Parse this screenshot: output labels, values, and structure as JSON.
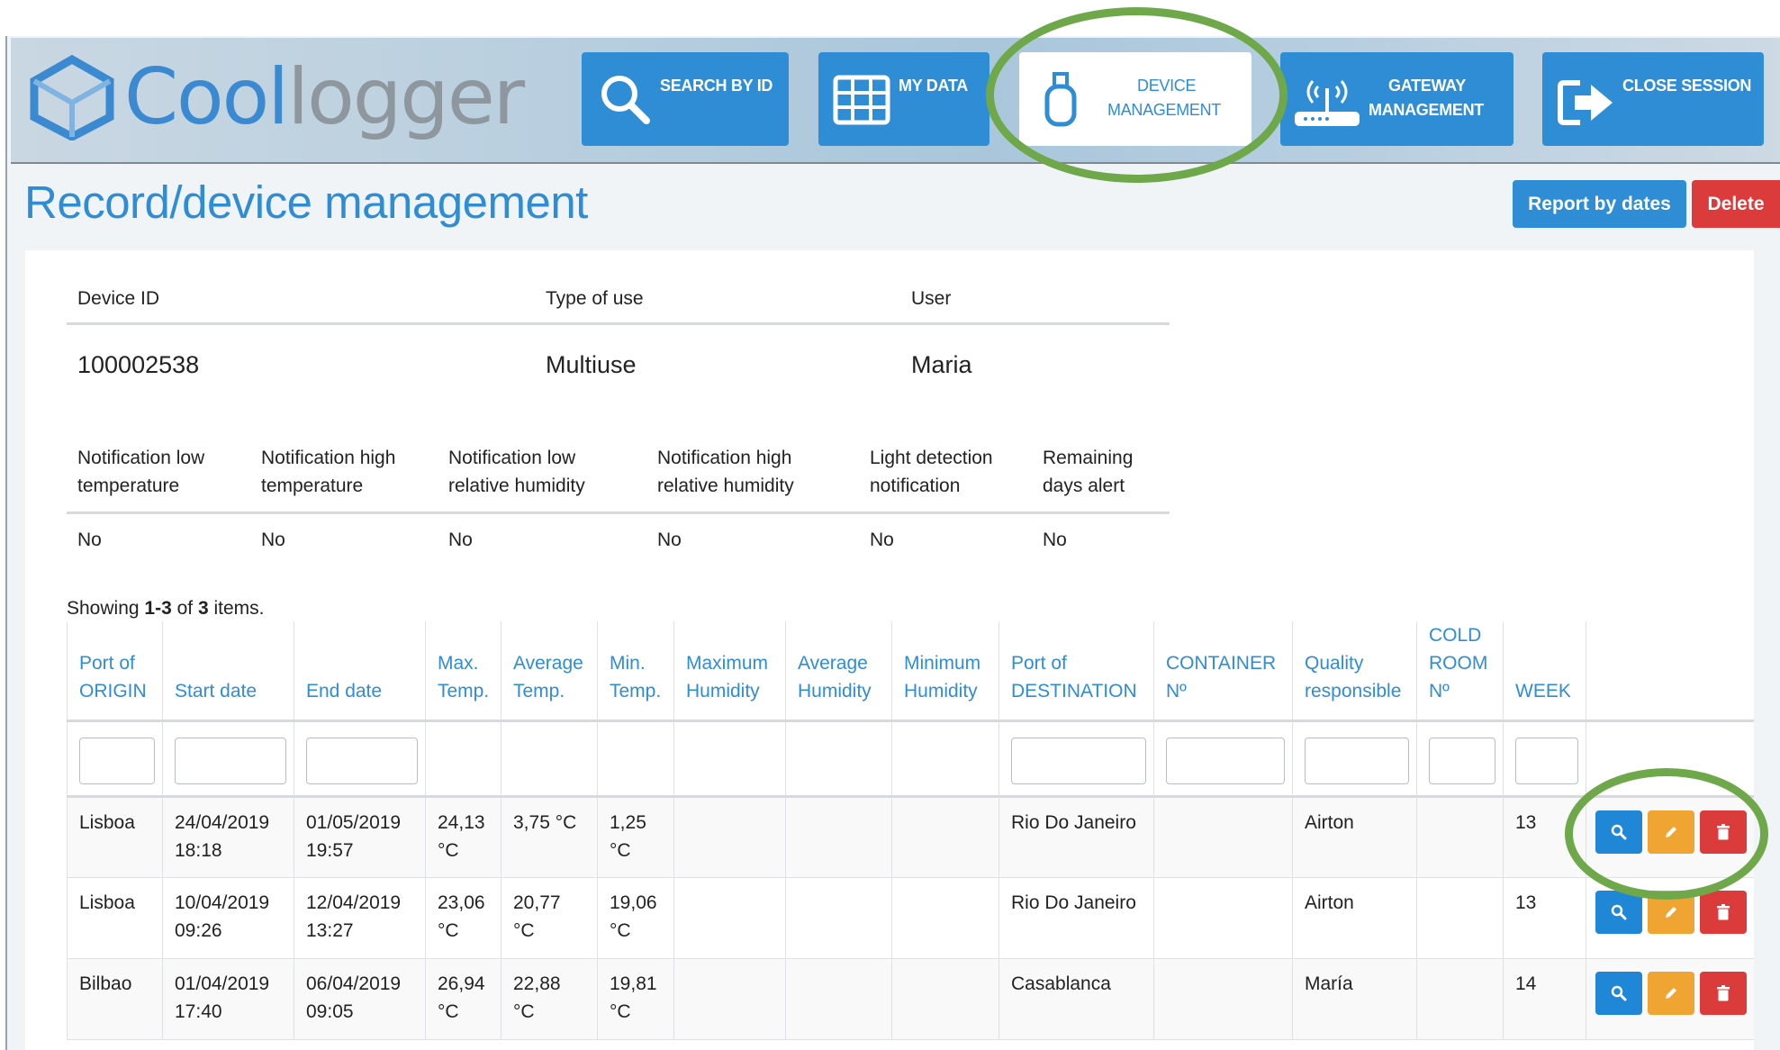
{
  "app": {
    "logo_part1": "Cool",
    "logo_part2": "logger"
  },
  "nav": {
    "search": "SEARCH BY ID",
    "mydata": "MY DATA",
    "device_line1": "DEVICE",
    "device_line2": "MANAGEMENT",
    "gateway_line1": "GATEWAY",
    "gateway_line2": "MANAGEMENT",
    "close": "CLOSE SESSION"
  },
  "page": {
    "title": "Record/device management",
    "report_btn": "Report by dates",
    "delete_btn": "Delete"
  },
  "device": {
    "id_label": "Device ID",
    "type_label": "Type of use",
    "user_label": "User",
    "id": "100002538",
    "type": "Multiuse",
    "user": "Maria"
  },
  "notifications": {
    "headers": [
      [
        "Notification low",
        "temperature"
      ],
      [
        "Notification high",
        "temperature"
      ],
      [
        "Notification low",
        "relative humidity"
      ],
      [
        "Notification high",
        "relative humidity"
      ],
      [
        "Light detection",
        "notification"
      ],
      [
        "Remaining",
        "days alert"
      ]
    ],
    "values": [
      "No",
      "No",
      "No",
      "No",
      "No",
      "No"
    ]
  },
  "summary": {
    "prefix": "Showing ",
    "range": "1-3",
    "of": " of ",
    "total": "3",
    "suffix": " items."
  },
  "table": {
    "headers": [
      [
        "Port of",
        "ORIGIN"
      ],
      [
        "Start date"
      ],
      [
        "End date"
      ],
      [
        "Max.",
        "Temp."
      ],
      [
        "Average",
        "Temp."
      ],
      [
        "Min.",
        "Temp."
      ],
      [
        "Maximum",
        "Humidity"
      ],
      [
        "Average",
        "Humidity"
      ],
      [
        "Minimum",
        "Humidity"
      ],
      [
        "Port of",
        "DESTINATION"
      ],
      [
        "CONTAINER",
        "Nº"
      ],
      [
        "Quality",
        "responsible"
      ],
      [
        "COLD",
        "ROOM",
        "Nº"
      ],
      [
        "WEEK"
      ],
      [
        ""
      ]
    ],
    "rows": [
      [
        [
          "Lisboa"
        ],
        [
          "24/04/2019",
          "18:18"
        ],
        [
          "01/05/2019",
          "19:57"
        ],
        [
          "24,13",
          "°C"
        ],
        [
          "3,75 °C"
        ],
        [
          "1,25",
          "°C"
        ],
        [
          ""
        ],
        [
          ""
        ],
        [
          ""
        ],
        [
          "Rio Do Janeiro"
        ],
        [
          ""
        ],
        [
          "Airton"
        ],
        [
          ""
        ],
        [
          "13"
        ]
      ],
      [
        [
          "Lisboa"
        ],
        [
          "10/04/2019",
          "09:26"
        ],
        [
          "12/04/2019",
          "13:27"
        ],
        [
          "23,06",
          "°C"
        ],
        [
          "20,77",
          "°C"
        ],
        [
          "19,06",
          "°C"
        ],
        [
          ""
        ],
        [
          ""
        ],
        [
          ""
        ],
        [
          "Rio Do Janeiro"
        ],
        [
          ""
        ],
        [
          "Airton"
        ],
        [
          ""
        ],
        [
          "13"
        ]
      ],
      [
        [
          "Bilbao"
        ],
        [
          "01/04/2019",
          "17:40"
        ],
        [
          "06/04/2019",
          "09:05"
        ],
        [
          "26,94",
          "°C"
        ],
        [
          "22,88",
          "°C"
        ],
        [
          "19,81",
          "°C"
        ],
        [
          ""
        ],
        [
          ""
        ],
        [
          ""
        ],
        [
          "Casablanca"
        ],
        [
          ""
        ],
        [
          "María"
        ],
        [
          ""
        ],
        [
          "14"
        ]
      ]
    ]
  },
  "icons": {
    "search": "search-icon",
    "grid": "grid-icon",
    "usb": "usb-icon",
    "gateway": "wifi-router-icon",
    "logout": "logout-icon",
    "view": "magnifier-icon",
    "edit": "pencil-icon",
    "delete": "trash-icon"
  },
  "colors": {
    "brand_blue": "#2f8dd6",
    "highlight_green": "#6fa84a",
    "danger_red": "#dc3b3b",
    "edit_orange": "#f0a432"
  }
}
